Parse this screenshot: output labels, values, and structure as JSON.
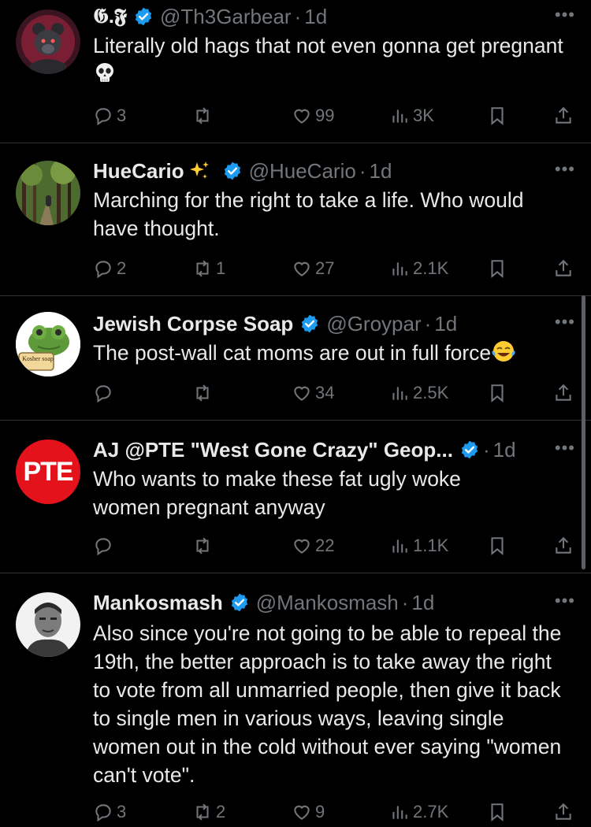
{
  "tweets": [
    {
      "name": "𝕲.𝕱",
      "handle": "@Th3Garbear",
      "time": "1d",
      "text": "Literally old hags that not even gonna get pregnant",
      "emoji": "skull",
      "replies": "3",
      "retweets": "",
      "likes": "99",
      "views": "3K"
    },
    {
      "name": "HueCario",
      "name_emoji": "sparkles",
      "handle": "@HueCario",
      "time": "1d",
      "text": "Marching for the right to take a life. Who would have thought.",
      "replies": "2",
      "retweets": "1",
      "likes": "27",
      "views": "2.1K"
    },
    {
      "name": "Jewish Corpse Soap",
      "handle": "@Groypar",
      "time": "1d",
      "text": "The post-wall cat moms are out in full force",
      "emoji": "tears-of-joy",
      "avatar_label": "Kosher soap",
      "replies": "",
      "retweets": "",
      "likes": "34",
      "views": "2.5K"
    },
    {
      "name": "AJ @PTE \"West Gone Crazy\" Geop...",
      "handle": "",
      "time": "1d",
      "text": "Who wants to make these fat ugly woke women pregnant anyway",
      "avatar_label": "PTE",
      "replies": "",
      "retweets": "",
      "likes": "22",
      "views": "1.1K"
    },
    {
      "name": "Mankosmash",
      "handle": "@Mankosmash",
      "time": "1d",
      "text": "Also since you're not going to be able to repeal the 19th, the better approach is to take away the right to vote from all unmarried people, then give it back to single men in various ways, leaving single women out in the cold without ever saying \"women can't vote\".",
      "replies": "3",
      "retweets": "2",
      "likes": "9",
      "views": "2.7K"
    }
  ],
  "separator": "·",
  "more_icon": "ellipsis-icon",
  "colors": {
    "background": "#000000",
    "text": "#e7e9ea",
    "muted": "#71767b",
    "verified": "#1d9bf0",
    "divider": "#2f3336"
  }
}
